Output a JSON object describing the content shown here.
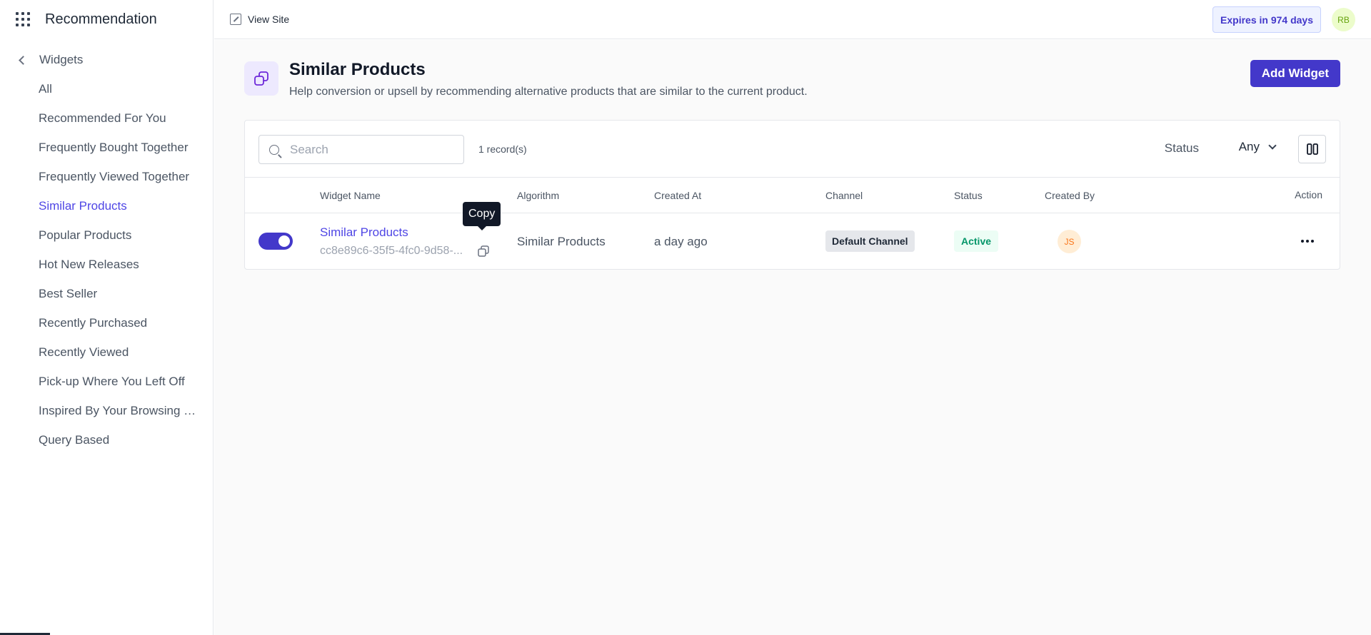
{
  "app": {
    "title": "Recommendation"
  },
  "sidebar": {
    "back_label": "Widgets",
    "items": [
      {
        "label": "All"
      },
      {
        "label": "Recommended For You"
      },
      {
        "label": "Frequently Bought Together"
      },
      {
        "label": "Frequently Viewed Together"
      },
      {
        "label": "Similar Products",
        "active": true
      },
      {
        "label": "Popular Products"
      },
      {
        "label": "Hot New Releases"
      },
      {
        "label": "Best Seller"
      },
      {
        "label": "Recently Purchased"
      },
      {
        "label": "Recently Viewed"
      },
      {
        "label": "Pick-up Where You Left Off"
      },
      {
        "label": "Inspired By Your Browsing H..."
      },
      {
        "label": "Query Based"
      }
    ]
  },
  "topbar": {
    "view_site": "View Site",
    "expires": "Expires in 974 days",
    "user_initials": "RB"
  },
  "page": {
    "title": "Similar Products",
    "description": "Help conversion or upsell by recommending alternative products that are similar to the current product.",
    "add_button": "Add Widget"
  },
  "toolbar": {
    "search_placeholder": "Search",
    "records": "1 record(s)",
    "status_label": "Status",
    "status_value": "Any"
  },
  "table": {
    "columns": {
      "widget_name": "Widget Name",
      "algorithm": "Algorithm",
      "created_at": "Created At",
      "channel": "Channel",
      "status": "Status",
      "created_by": "Created By",
      "action": "Action"
    },
    "rows": [
      {
        "enabled": true,
        "name": "Similar Products",
        "id": "cc8e89c6-35f5-4fc0-9d58-...",
        "algorithm": "Similar Products",
        "created_at": "a day ago",
        "channel": "Default Channel",
        "status": "Active",
        "created_by": "JS"
      }
    ]
  },
  "tooltip": {
    "copy": "Copy"
  },
  "colors": {
    "accent": "#4338ca",
    "link": "#4f46e5",
    "active_status": "#059669"
  }
}
